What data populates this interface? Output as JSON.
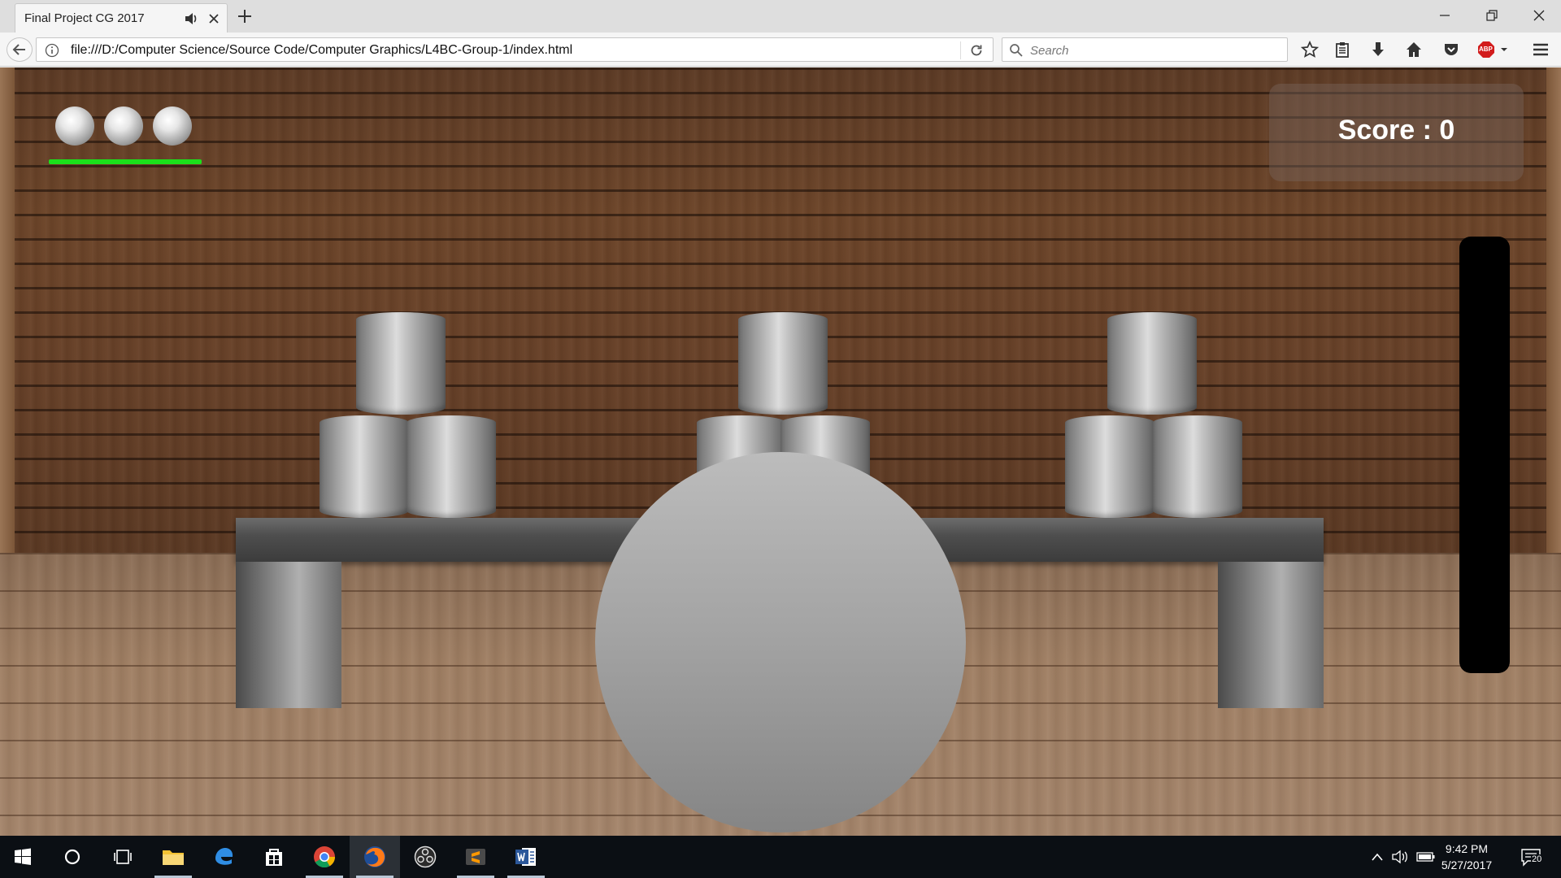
{
  "browser": {
    "tab_title": "Final Project CG 2017",
    "url": "file:///D:/Computer Science/Source Code/Computer Graphics/L4BC-Group-1/index.html",
    "search_placeholder": "Search",
    "adblock_label": "ABP"
  },
  "game": {
    "lives_remaining": 3,
    "health_fraction": 1.0,
    "score_text": "Score : 0",
    "power_fraction": 0.0
  },
  "taskbar": {
    "apps": [
      "start",
      "cortana",
      "task-view",
      "file-explorer",
      "edge",
      "store",
      "chrome",
      "firefox",
      "obs",
      "sublime-text",
      "word"
    ],
    "active_app": "firefox",
    "clock_time": "9:42 PM",
    "clock_date": "5/27/2017",
    "notification_count": "20"
  },
  "colors": {
    "health": "#1be01b",
    "score_text": "#ffffff",
    "taskbar": "#0b0f14"
  }
}
